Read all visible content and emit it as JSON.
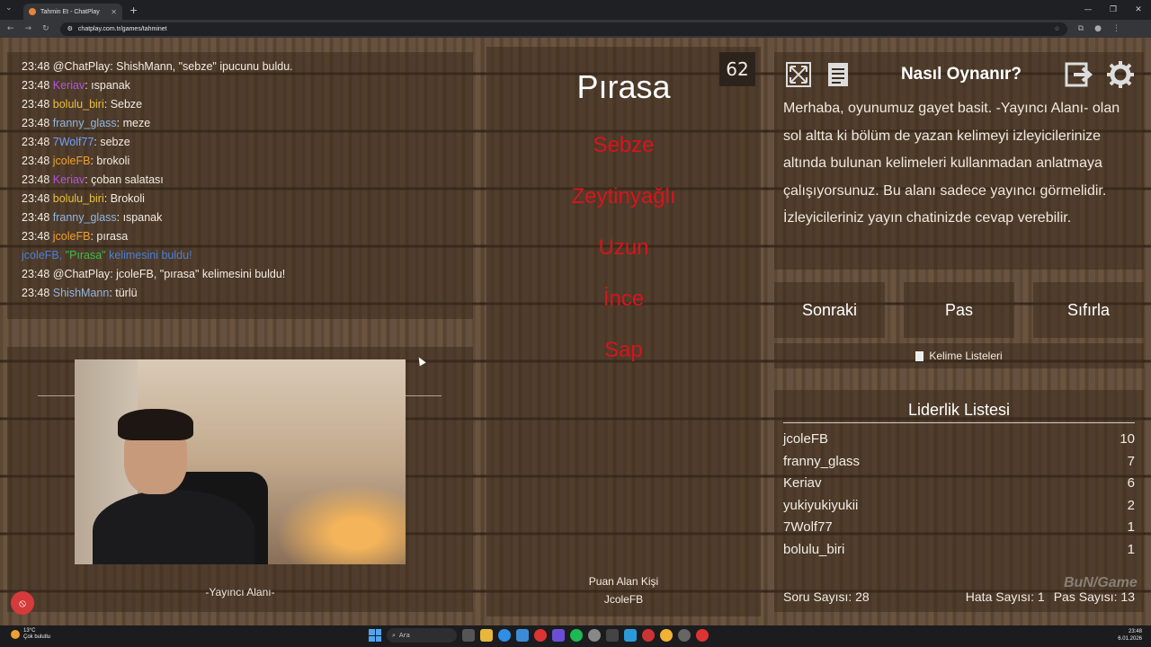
{
  "browser": {
    "tab_title": "Tahmin Et - ChatPlay",
    "url": "chatplay.com.tr/games/tahminet"
  },
  "chat": {
    "messages": [
      {
        "time": "23:48",
        "user": "@ChatPlay",
        "color": "#f2ece4",
        "text": ": ShishMann, \"sebze\" ipucunu buldu."
      },
      {
        "time": "23:48",
        "user": "Keriav",
        "color": "#b455e0",
        "text": ": ıspanak"
      },
      {
        "time": "23:48",
        "user": "bolulu_biri",
        "color": "#e8c040",
        "text": ": Sebze"
      },
      {
        "time": "23:48",
        "user": "franny_glass",
        "color": "#8fb6e0",
        "text": ": meze"
      },
      {
        "time": "23:48",
        "user": "7Wolf77",
        "color": "#6fa0ff",
        "text": ": sebze"
      },
      {
        "time": "23:48",
        "user": "jcoleFB",
        "color": "#f0a030",
        "text": ": brokoli"
      },
      {
        "time": "23:48",
        "user": "Keriav",
        "color": "#b455e0",
        "text": ": çoban salatası"
      },
      {
        "time": "23:48",
        "user": "bolulu_biri",
        "color": "#e8c040",
        "text": ": Brokoli"
      },
      {
        "time": "23:48",
        "user": "franny_glass",
        "color": "#8fb6e0",
        "text": ": ıspanak"
      },
      {
        "time": "23:48",
        "user": "jcoleFB",
        "color": "#f0a030",
        "text": ": pırasa"
      }
    ],
    "system": {
      "user": "jcoleFB, ",
      "word": "\"Pırasa\"",
      "rest": " kelimesini buldu!"
    },
    "after": [
      {
        "time": "23:48",
        "user": "@ChatPlay",
        "color": "#f2ece4",
        "text": ": jcoleFB, \"pırasa\" kelimesini buldu!"
      },
      {
        "time": "23:48",
        "user": "ShishMann",
        "color": "#8fb6e0",
        "text": ": türlü"
      }
    ]
  },
  "streamer": {
    "label": "-Yayıncı Alanı-"
  },
  "game": {
    "timer": "62",
    "word": "Pırasa",
    "taboo": [
      "Sebze",
      "Zeytinyağlı",
      "Uzun",
      "İnce",
      "Sap"
    ],
    "scorer_title": "Puan Alan Kişi",
    "scorer_name": "JcoleFB"
  },
  "howto": {
    "title": "Nasıl Oynanır?",
    "text": "Merhaba, oyunumuz gayet basit. -Yayıncı Alanı- olan sol altta ki bölüm de yazan kelimeyi izleyicilerinize altında bulunan kelimeleri kullanmadan anlatmaya çalışıyorsunuz. Bu alanı sadece yayıncı görmelidir. İzleyicileriniz yayın chatinizde cevap verebilir."
  },
  "controls": {
    "next": "Sonraki",
    "pass": "Pas",
    "reset": "Sıfırla",
    "word_lists": "Kelime Listeleri"
  },
  "leaderboard": {
    "title": "Liderlik Listesi",
    "rows": [
      {
        "name": "jcoleFB",
        "score": "10"
      },
      {
        "name": "franny_glass",
        "score": "7"
      },
      {
        "name": "Keriav",
        "score": "6"
      },
      {
        "name": "yukiyukiyukii",
        "score": "2"
      },
      {
        "name": "7Wolf77",
        "score": "1"
      },
      {
        "name": "bolulu_biri",
        "score": "1"
      }
    ],
    "question_count": "Soru Sayısı: 28",
    "error_count": "Hata Sayısı: 1",
    "pass_count": "Pas Sayısı: 13"
  },
  "watermark": "BuN/Game",
  "taskbar": {
    "temp": "13°C",
    "weather": "Çok bulutlu",
    "search": "Ara",
    "time": "23:48",
    "date": "6.01.2026"
  }
}
